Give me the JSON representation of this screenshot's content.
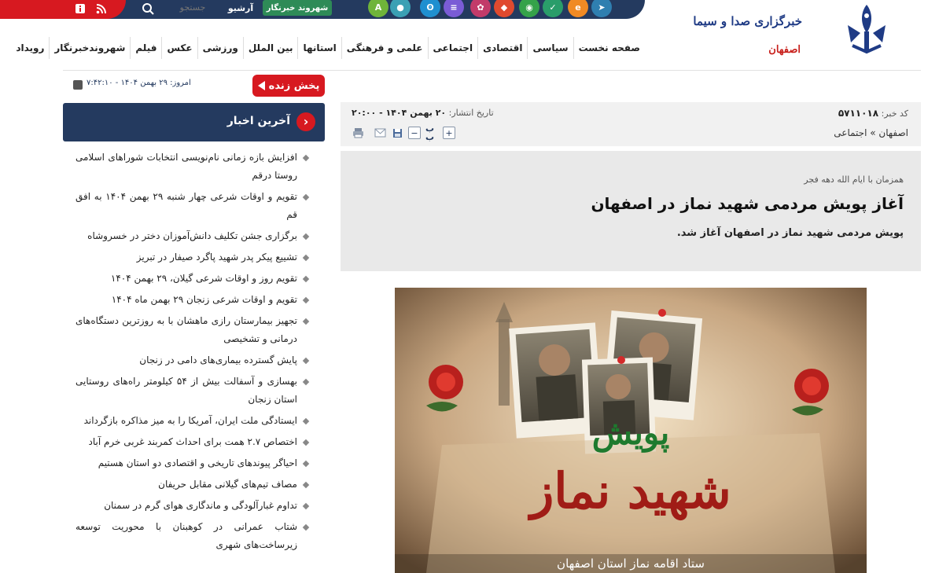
{
  "topbar": {
    "search_placeholder": "جستجو",
    "archive_label": "آرشیو",
    "citizen_reporter_label": "شهروند خبرنگار",
    "colors": {
      "bar": "#243a5f",
      "accent": "#d71920",
      "citizen_btn": "#2e8b57"
    }
  },
  "brand": {
    "name": "خبرگزاری صدا و سیما",
    "region": "اصفهان"
  },
  "nav": [
    {
      "label": "صفحه نخست"
    },
    {
      "label": "سیاسی"
    },
    {
      "label": "اقتصادی"
    },
    {
      "label": "اجتماعی"
    },
    {
      "label": "علمی و فرهنگی"
    },
    {
      "label": "استانها"
    },
    {
      "label": "بین الملل"
    },
    {
      "label": "ورزشی"
    },
    {
      "label": "عکس"
    },
    {
      "label": "فیلم"
    },
    {
      "label": "شهروندخبرنگار"
    },
    {
      "label": "رویداد"
    }
  ],
  "sidebar": {
    "live_label": "پخش زنده",
    "today": "امروز: ۲۹ بهمن ۱۴۰۴ - ۷:۴۲:۱۰",
    "latest_title": "آخرین اخبار",
    "news": [
      "افزایش بازه زمانی نام‌نویسی انتخابات شوراهای اسلامی روستا درقم",
      "تقویم و اوقات شرعی چهار شنبه ۲۹ بهمن ۱۴۰۴ به افق قم",
      "برگزاری جشن تکلیف دانش‌آموزان دختر در خسروشاه",
      "تشییع پیکر پدر شهید پاگرد صیفار در تبریز",
      "تقویم روز و اوقات شرعی گیلان، ۲۹ بهمن ۱۴۰۴",
      "تقویم و اوقات شرعی زنجان ۲۹ بهمن ماه ۱۴۰۴",
      "تجهیز بیمارستان رازی ماهشان با به روزترین دستگاه‌های درمانی و تشخیصی",
      "پایش گسترده بیماری‌های دامی در زنجان",
      "بهسازی و آسفالت بیش از ۵۴ کیلومتر راه‌های روستایی استان زنجان",
      "ایستادگی ملت ایران، آمریکا را به میز مذاکره بازگرداند",
      "اختصاص ۲.۷ همت برای احداث کمربند غربی خرم آباد",
      "احیاگر پیوندهای تاریخی و اقتصادی دو استان هستیم",
      "مصاف تیم‌های گیلانی مقابل حریفان",
      "تداوم غبارآلودگی و ماندگاری هوای گرم در سمنان",
      "شتاب عمرانی در کوهبنان با محوریت توسعه زیرساخت‌های شهری"
    ]
  },
  "article": {
    "code_label": "کد خبر:",
    "code_value": "۵۷۱۱۰۱۸",
    "date_label": "تاریخ انتشار:",
    "date_value": "۲۰ بهمن ۱۴۰۴ - ۲۰:۰۰",
    "breadcrumb": "اصفهان » اجتماعی",
    "rutitr": "همزمان با ایام الله دهه فجر",
    "headline": "آغاز پویش مردمی شهید نماز در اصفهان",
    "lead": "پویش مردمی شهید نماز در اصفهان آغاز شد.",
    "font_tool": "ب ب",
    "poster": {
      "title": "پویش",
      "main": "شهید نماز",
      "footer": "ستاد اقامه نماز استان اصفهان"
    }
  }
}
